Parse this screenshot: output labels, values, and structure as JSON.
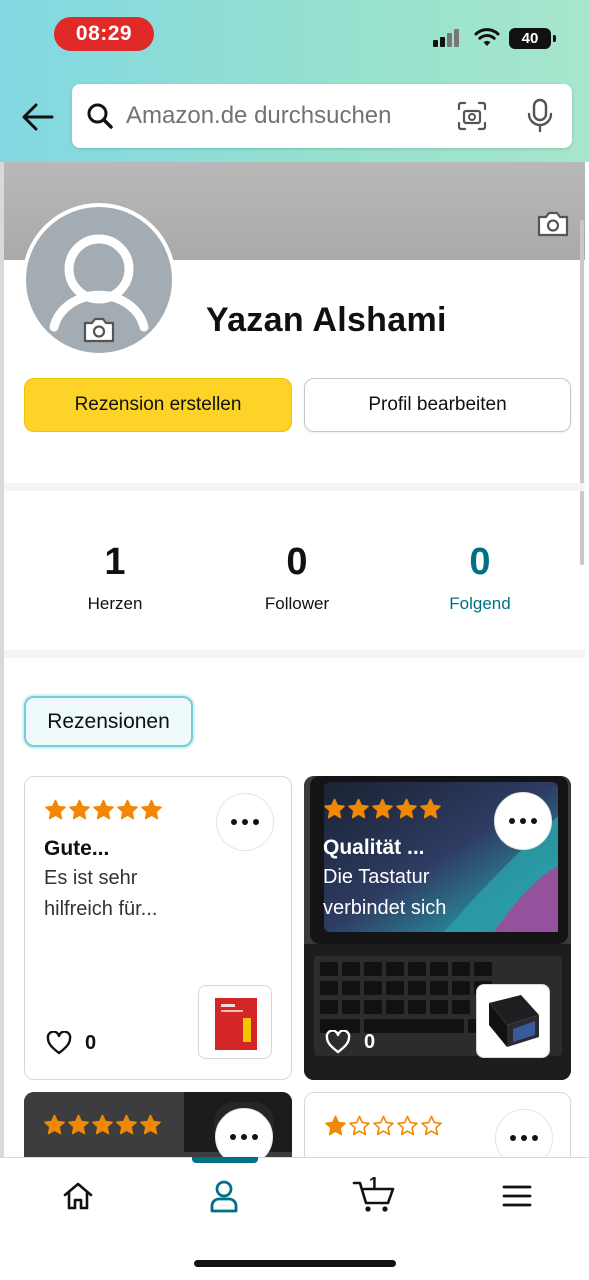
{
  "status_bar": {
    "time": "08:29",
    "battery": "40"
  },
  "search": {
    "placeholder": "Amazon.de durchsuchen"
  },
  "profile": {
    "name": "Yazan Alshami",
    "create_review_label": "Rezension erstellen",
    "edit_profile_label": "Profil bearbeiten"
  },
  "stats": [
    {
      "value": "1",
      "label": "Herzen"
    },
    {
      "value": "0",
      "label": "Follower"
    },
    {
      "value": "0",
      "label": "Folgend"
    }
  ],
  "filter_chip": "Rezensionen",
  "reviews": [
    {
      "rating": 5,
      "title": "Gute...",
      "text_line1": "Es ist sehr",
      "text_line2": "hilfreich für...",
      "likes": "0"
    },
    {
      "rating": 5,
      "title": "Qualität ...",
      "text_line1": "Die Tastatur",
      "text_line2": "verbindet sich",
      "likes": "0"
    },
    {
      "rating": 5
    },
    {
      "rating": 1
    }
  ],
  "colors": {
    "header_gradient": [
      "#82d8e3",
      "#a6e6cc"
    ],
    "primary_button": "#fed328",
    "teal_accent": "#007185",
    "star": "#f08804",
    "time_pill": "#e02a2a"
  },
  "nav": {
    "items": [
      "home-icon",
      "profile-icon",
      "cart-icon",
      "menu-icon"
    ],
    "active": "profile-icon",
    "cart_count": "1"
  }
}
